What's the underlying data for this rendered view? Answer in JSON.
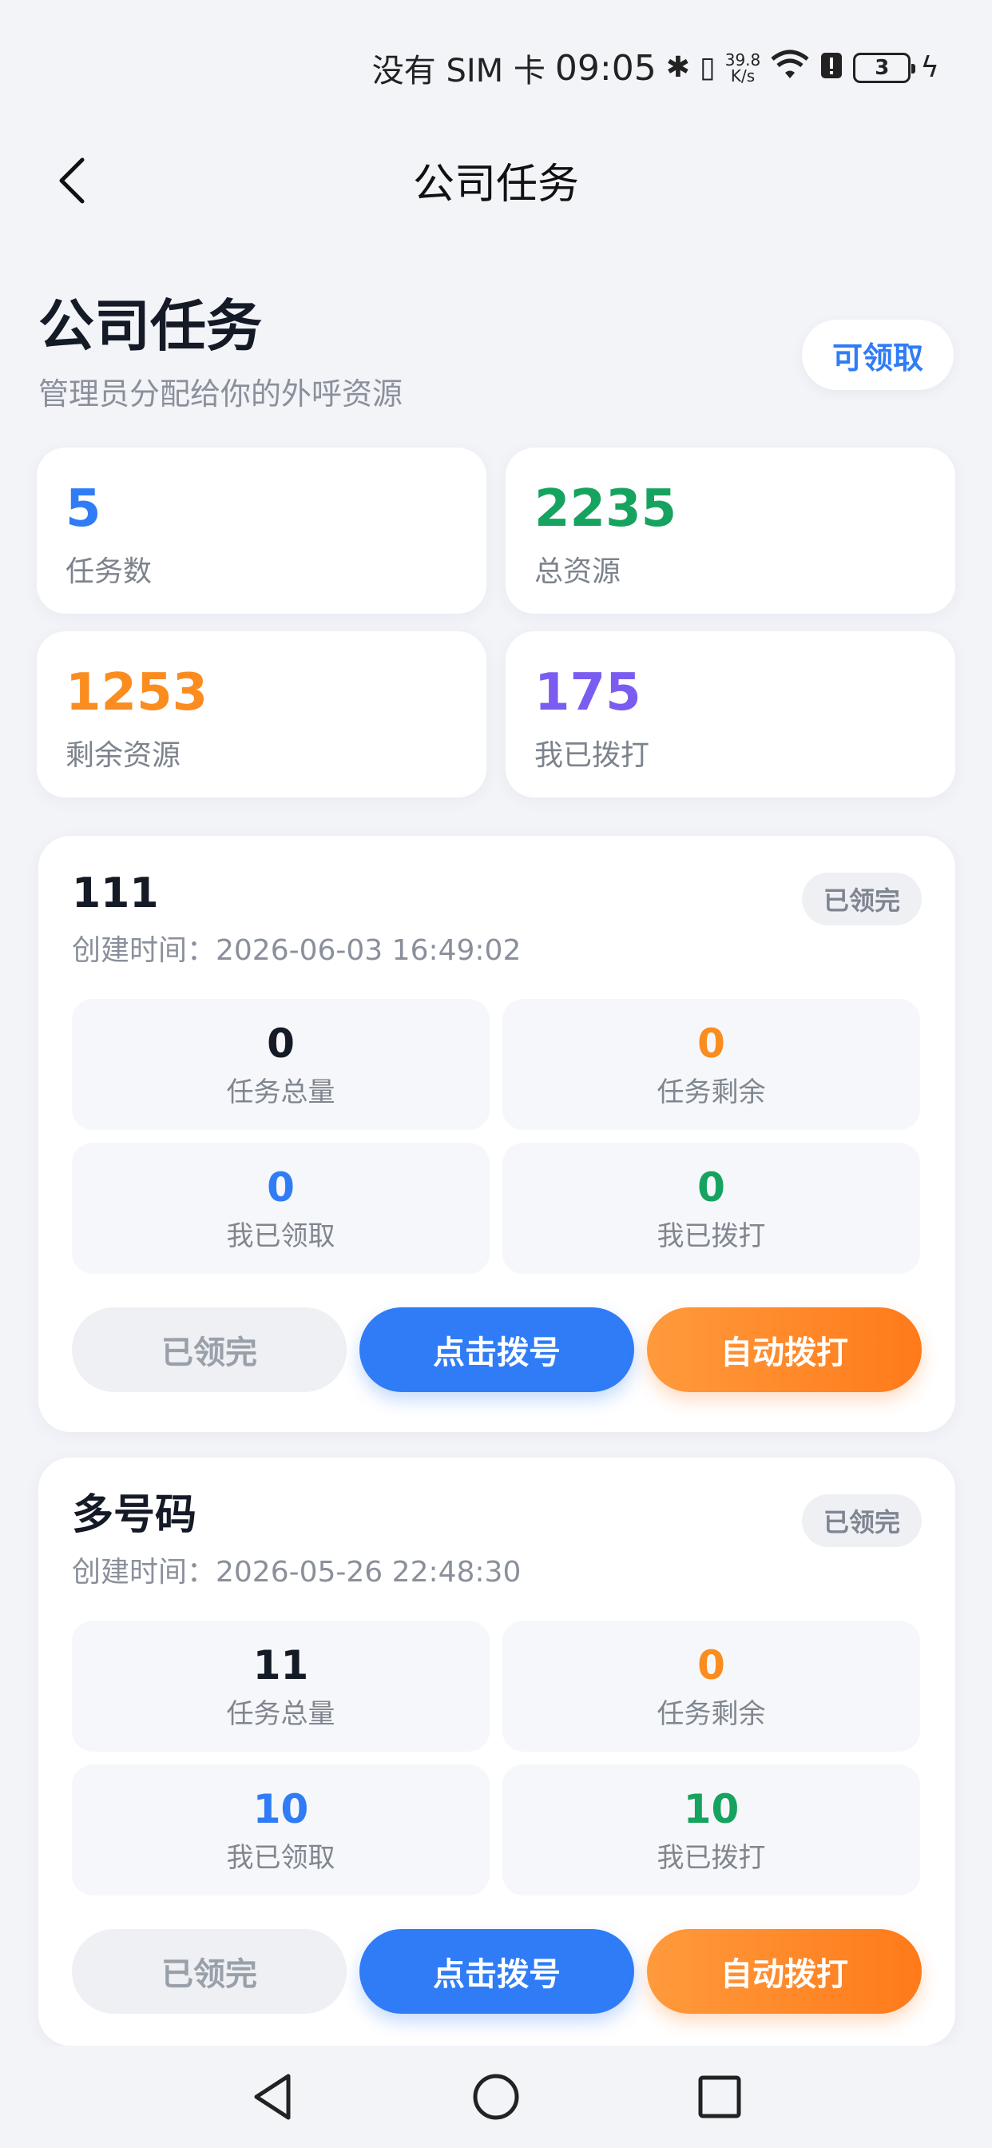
{
  "status_bar": {
    "sim": "没有 SIM 卡",
    "time": "09:05",
    "speed_value": "39.8",
    "speed_unit": "K/s",
    "battery": "3"
  },
  "navbar": {
    "title": "公司任务"
  },
  "header": {
    "title": "公司任务",
    "subtitle": "管理员分配给你的外呼资源",
    "claim_label": "可领取"
  },
  "stats": [
    {
      "value": "5",
      "label": "任务数",
      "color": "#2f7cf6"
    },
    {
      "value": "2235",
      "label": "总资源",
      "color": "#16a35f"
    },
    {
      "value": "1253",
      "label": "剩余资源",
      "color": "#fb8c1f"
    },
    {
      "value": "175",
      "label": "我已拨打",
      "color": "#7b5cf0"
    }
  ],
  "tasks": [
    {
      "name": "111",
      "badge": "已领完",
      "created": "创建时间：2026-06-03 16:49:02",
      "metrics": [
        {
          "value": "0",
          "label": "任务总量",
          "color": "#141a26"
        },
        {
          "value": "0",
          "label": "任务剩余",
          "color": "#fb8c1f"
        },
        {
          "value": "0",
          "label": "我已领取",
          "color": "#2f7cf6"
        },
        {
          "value": "0",
          "label": "我已拨打",
          "color": "#16a35f"
        }
      ],
      "buttons": {
        "done": "已领完",
        "dial": "点击拨号",
        "auto": "自动拨打"
      }
    },
    {
      "name": "多号码",
      "badge": "已领完",
      "created": "创建时间：2026-05-26 22:48:30",
      "metrics": [
        {
          "value": "11",
          "label": "任务总量",
          "color": "#141a26"
        },
        {
          "value": "0",
          "label": "任务剩余",
          "color": "#fb8c1f"
        },
        {
          "value": "10",
          "label": "我已领取",
          "color": "#2f7cf6"
        },
        {
          "value": "10",
          "label": "我已拨打",
          "color": "#16a35f"
        }
      ],
      "buttons": {
        "done": "已领完",
        "dial": "点击拨号",
        "auto": "自动拨打"
      }
    }
  ]
}
